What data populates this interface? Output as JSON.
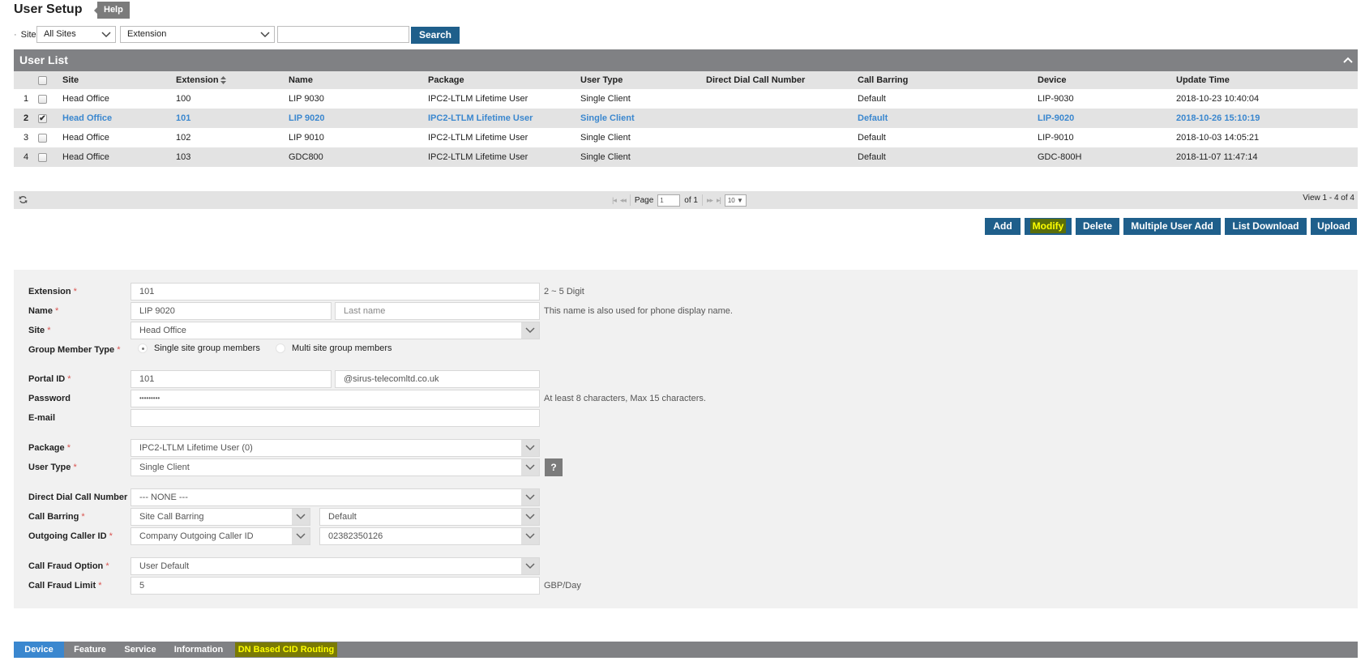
{
  "header": {
    "title": "User Setup",
    "help_label": "Help"
  },
  "search": {
    "site_label": "Site",
    "site_value": "All Sites",
    "field_value": "Extension",
    "query_value": "",
    "search_label": "Search"
  },
  "user_list": {
    "title": "User List",
    "columns": [
      "",
      "",
      "Site",
      "Extension",
      "Name",
      "Package",
      "User Type",
      "Direct Dial Call Number",
      "Call Barring",
      "Device",
      "Update Time"
    ],
    "rows": [
      {
        "num": "1",
        "checked": false,
        "site": "Head Office",
        "extension": "100",
        "name": "LIP 9030",
        "package": "IPC2-LTLM Lifetime User",
        "user_type": "Single Client",
        "ddi": "",
        "call_barring": "Default",
        "device": "LIP-9030",
        "update_time": "2018-10-23 10:40:04"
      },
      {
        "num": "2",
        "checked": true,
        "site": "Head Office",
        "extension": "101",
        "name": "LIP 9020",
        "package": "IPC2-LTLM Lifetime User",
        "user_type": "Single Client",
        "ddi": "",
        "call_barring": "Default",
        "device": "LIP-9020",
        "update_time": "2018-10-26 15:10:19"
      },
      {
        "num": "3",
        "checked": false,
        "site": "Head Office",
        "extension": "102",
        "name": "LIP 9010",
        "package": "IPC2-LTLM Lifetime User",
        "user_type": "Single Client",
        "ddi": "",
        "call_barring": "Default",
        "device": "LIP-9010",
        "update_time": "2018-10-03 14:05:21"
      },
      {
        "num": "4",
        "checked": false,
        "site": "Head Office",
        "extension": "103",
        "name": "GDC800",
        "package": "IPC2-LTLM Lifetime User",
        "user_type": "Single Client",
        "ddi": "",
        "call_barring": "Default",
        "device": "GDC-800H",
        "update_time": "2018-11-07 11:47:14"
      }
    ],
    "selected_color": "#3a87cf"
  },
  "pager": {
    "page_label": "Page",
    "page_value": "1",
    "of_label": "of 1",
    "rows_per_page": "10",
    "view_count": "View 1 - 4 of 4"
  },
  "actions": {
    "add": "Add",
    "modify": "Modify",
    "delete": "Delete",
    "multiple_user_add": "Multiple User Add",
    "list_download": "List Download",
    "upload": "Upload"
  },
  "form": {
    "extension": {
      "label": "Extension",
      "value": "101",
      "hint": "2 ~ 5 Digit"
    },
    "name": {
      "label": "Name",
      "first": "LIP 9020",
      "last_placeholder": "Last name",
      "hint": "This name is also used for phone display name."
    },
    "site": {
      "label": "Site",
      "value": "Head Office"
    },
    "group_member_type": {
      "label": "Group Member Type",
      "options": [
        "Single site group members",
        "Multi site group members"
      ],
      "selected": 0
    },
    "portal_id": {
      "label": "Portal ID",
      "value": "101",
      "domain": "@sirus-telecomltd.co.uk"
    },
    "password": {
      "label": "Password",
      "value": "•••••••••",
      "hint": "At least 8 characters, Max 15 characters."
    },
    "email": {
      "label": "E-mail",
      "value": ""
    },
    "package": {
      "label": "Package",
      "value": "IPC2-LTLM Lifetime User (0)"
    },
    "user_type": {
      "label": "User Type",
      "value": "Single Client",
      "help": "?"
    },
    "ddi": {
      "label": "Direct Dial Call Number",
      "value": "--- NONE ---"
    },
    "call_barring": {
      "label": "Call Barring",
      "type": "Site Call Barring",
      "value": "Default"
    },
    "outgoing_cid": {
      "label": "Outgoing Caller ID",
      "type": "Company Outgoing Caller ID",
      "value": "02382350126"
    },
    "fraud_option": {
      "label": "Call Fraud Option",
      "value": "User Default"
    },
    "fraud_limit": {
      "label": "Call Fraud Limit",
      "value": "5",
      "unit": "GBP/Day"
    },
    "required_mark": "*"
  },
  "tabs": [
    {
      "label": "Device",
      "active": true
    },
    {
      "label": "Feature",
      "active": false
    },
    {
      "label": "Service",
      "active": false
    },
    {
      "label": "Information",
      "active": false
    },
    {
      "label": "DN Based CID Routing",
      "active": false,
      "highlighted": true
    }
  ]
}
